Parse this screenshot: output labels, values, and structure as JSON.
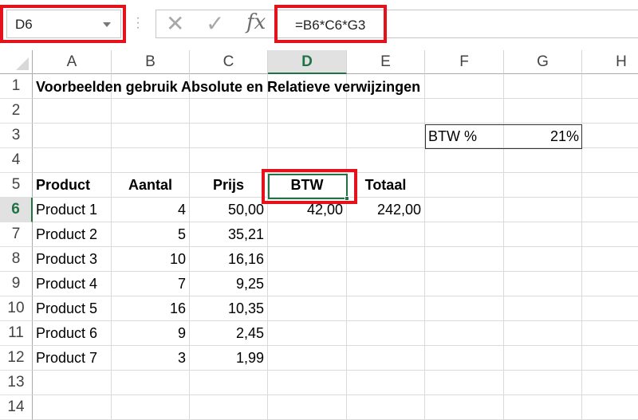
{
  "formula_bar": {
    "name_box": "D6",
    "cancel_icon": "✕",
    "enter_icon": "✓",
    "fx_label": "fx",
    "formula": "=B6*C6*G3"
  },
  "columns": [
    "A",
    "B",
    "C",
    "D",
    "E",
    "F",
    "G",
    "H"
  ],
  "selected_column": "D",
  "rows": [
    "1",
    "2",
    "3",
    "4",
    "5",
    "6",
    "7",
    "8",
    "9",
    "10",
    "11",
    "12",
    "13",
    "14"
  ],
  "selected_row": "6",
  "title": "Voorbeelden gebruik Absolute en Relatieve verwijzingen",
  "btw_label": "BTW %",
  "btw_value": "21%",
  "table": {
    "headers": [
      "Product",
      "Aantal",
      "Prijs",
      "BTW",
      "Totaal"
    ],
    "rows": [
      [
        "Product 1",
        "4",
        "50,00",
        "42,00",
        "242,00"
      ],
      [
        "Product 2",
        "5",
        "35,21",
        "",
        ""
      ],
      [
        "Product 3",
        "10",
        "16,16",
        "",
        ""
      ],
      [
        "Product 4",
        "7",
        "9,25",
        "",
        ""
      ],
      [
        "Product 5",
        "16",
        "10,35",
        "",
        ""
      ],
      [
        "Product 6",
        "9",
        "2,45",
        "",
        ""
      ],
      [
        "Product 7",
        "3",
        "1,99",
        "",
        ""
      ]
    ]
  },
  "colors": {
    "highlight_red": "#e4131b",
    "excel_green": "#217346"
  }
}
